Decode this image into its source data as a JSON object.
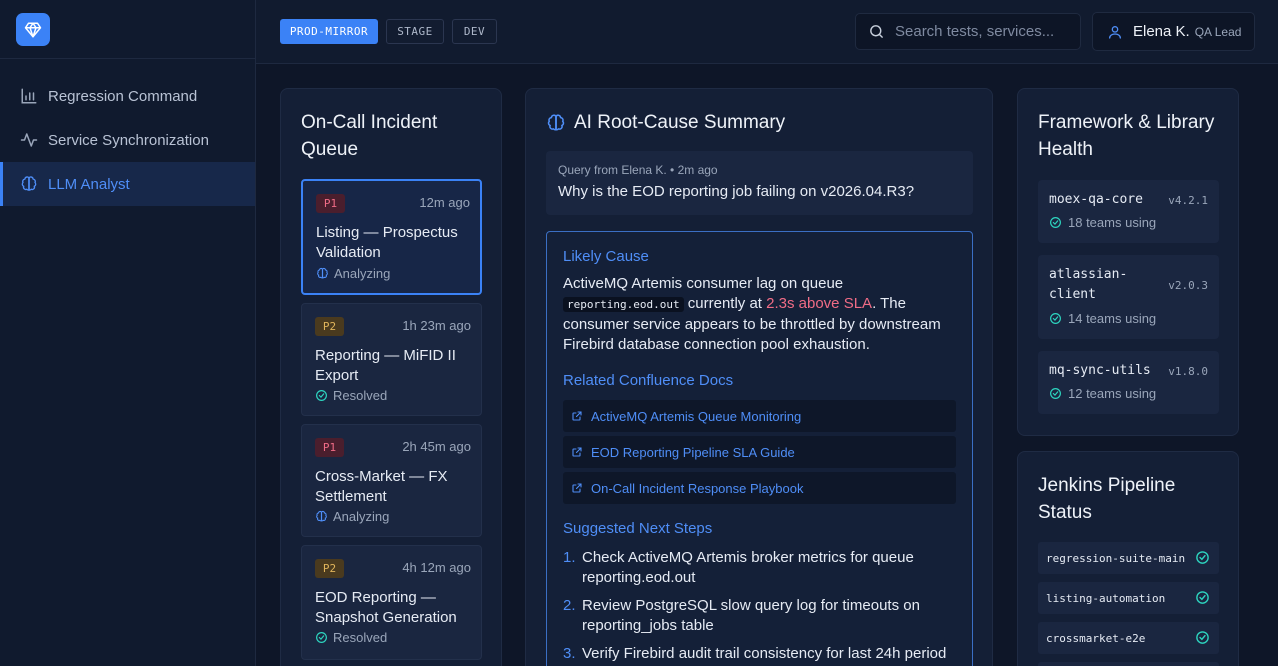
{
  "sidebar": {
    "items": [
      {
        "label": "Regression Command",
        "icon": "bar-chart-icon"
      },
      {
        "label": "Service Synchronization",
        "icon": "activity-icon"
      },
      {
        "label": "LLM Analyst",
        "icon": "brain-icon",
        "active": true
      }
    ]
  },
  "header": {
    "environments": [
      "PROD-MIRROR",
      "STAGE",
      "DEV"
    ],
    "active_environment": "PROD-MIRROR",
    "search_placeholder": "Search tests, services...",
    "user_name": "Elena K.",
    "user_role": "QA Lead"
  },
  "incidents": {
    "title": "On-Call Incident Queue",
    "items": [
      {
        "priority": "P1",
        "time": "12m ago",
        "title": "Listing — Prospectus Validation",
        "status": "Analyzing"
      },
      {
        "priority": "P2",
        "time": "1h 23m ago",
        "title": "Reporting — MiFID II Export",
        "status": "Resolved"
      },
      {
        "priority": "P1",
        "time": "2h 45m ago",
        "title": "Cross-Market — FX Settlement",
        "status": "Analyzing"
      },
      {
        "priority": "P2",
        "time": "4h 12m ago",
        "title": "EOD Reporting — Snapshot Generation",
        "status": "Resolved"
      }
    ]
  },
  "ai": {
    "title": "AI Root-Cause Summary",
    "query_meta": "Query from Elena K. • 2m ago",
    "query_text": "Why is the EOD reporting job failing on v2026.04.R3?",
    "likely_cause_heading": "Likely Cause",
    "cause_pre": "ActiveMQ Artemis consumer lag on queue",
    "cause_code": "reporting.eod.out",
    "cause_mid": "currently at",
    "cause_highlight": "2.3s above SLA",
    "cause_post": ". The consumer service appears to be throttled by downstream Firebird database connection pool exhaustion.",
    "docs_heading": "Related Confluence Docs",
    "docs": [
      "ActiveMQ Artemis Queue Monitoring",
      "EOD Reporting Pipeline SLA Guide",
      "On-Call Incident Response Playbook"
    ],
    "steps_heading": "Suggested Next Steps",
    "steps": [
      {
        "n": "1.",
        "text": "Check ActiveMQ Artemis broker metrics for queue reporting.eod.out"
      },
      {
        "n": "2.",
        "text": "Review PostgreSQL slow query log for timeouts on reporting_jobs table"
      },
      {
        "n": "3.",
        "text": "Verify Firebird audit trail consistency for last 24h period"
      }
    ]
  },
  "libraries": {
    "title": "Framework & Library Health",
    "items": [
      {
        "name": "moex-qa-core",
        "version": "v4.2.1",
        "usage": "18 teams using"
      },
      {
        "name": "atlassian-client",
        "version": "v2.0.3",
        "usage": "14 teams using"
      },
      {
        "name": "mq-sync-utils",
        "version": "v1.8.0",
        "usage": "12 teams using"
      }
    ]
  },
  "pipelines": {
    "title": "Jenkins Pipeline Status",
    "items": [
      {
        "name": "regression-suite-main",
        "status": "success"
      },
      {
        "name": "listing-automation",
        "status": "success"
      },
      {
        "name": "crossmarket-e2e",
        "status": "success"
      }
    ]
  },
  "colors": {
    "accent": "#3b82f6",
    "success": "#2dd4bf",
    "danger": "#f06c86",
    "warning": "#e0b45b"
  }
}
